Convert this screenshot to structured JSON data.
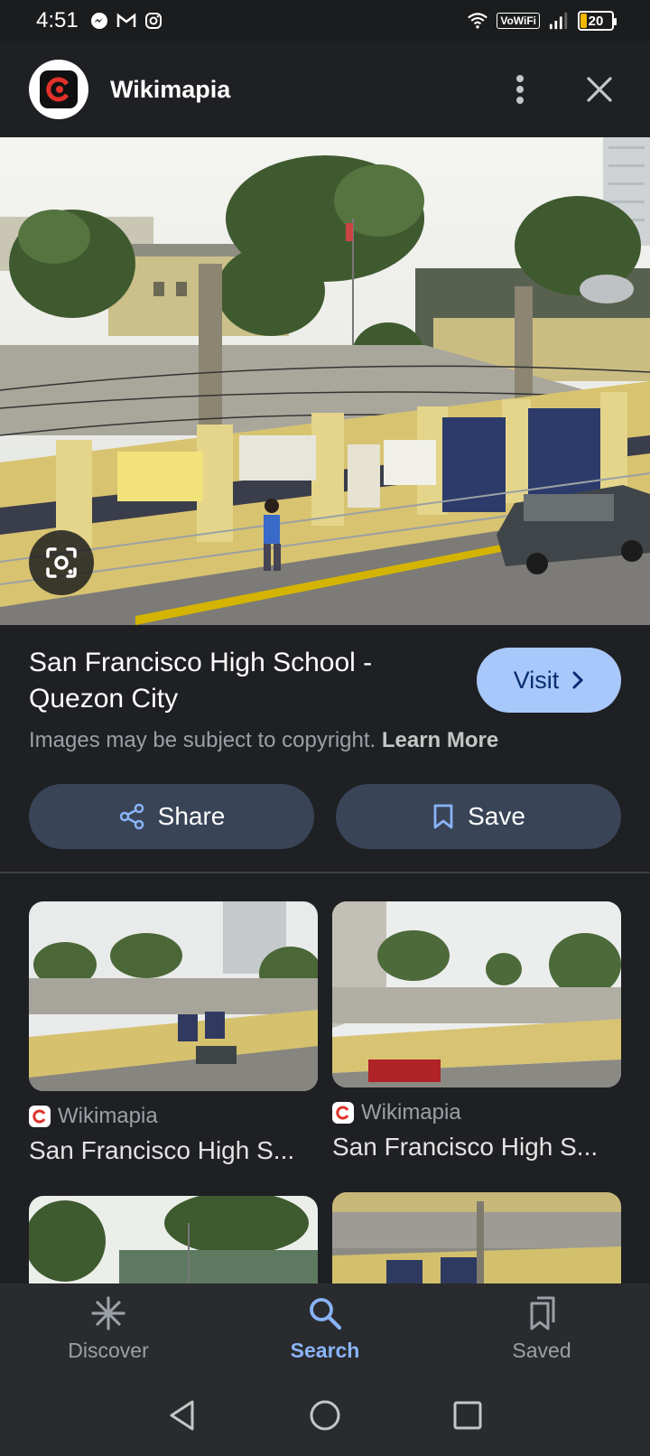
{
  "status_bar": {
    "time": "4:51",
    "network_label": "VoWiFi",
    "battery": "20",
    "battery_level": 20
  },
  "header": {
    "site_name": "Wikimapia",
    "logo_icon": "wikimapia-logo-icon",
    "more_icon": "more-vert-icon",
    "close_icon": "close-icon"
  },
  "result": {
    "title": "San Francisco High School - Quezon City",
    "visit_label": "Visit",
    "copyright_text": "Images may be subject to copyright.",
    "learn_more_label": "Learn More",
    "share_label": "Share",
    "save_label": "Save"
  },
  "related": [
    {
      "source": "Wikimapia",
      "title": "San Francisco High S..."
    },
    {
      "source": "Wikimapia",
      "title": "San Francisco High S..."
    }
  ],
  "bottom_nav": {
    "items": [
      {
        "label": "Discover",
        "icon": "asterisk-icon"
      },
      {
        "label": "Search",
        "icon": "search-icon"
      },
      {
        "label": "Saved",
        "icon": "bookmarks-icon"
      }
    ],
    "active": "Search"
  },
  "colors": {
    "background": "#1f2023",
    "accent": "#8ab4f8",
    "visit_button": "#a8c7fa",
    "chip": "#394457",
    "wall_yellow": "#d8c370"
  }
}
